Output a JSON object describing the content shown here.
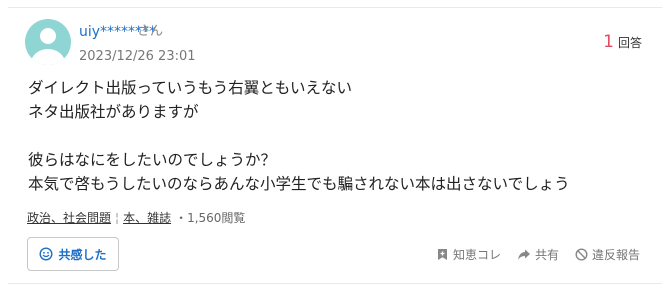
{
  "user": {
    "name": "uiy********",
    "honorific": "さん"
  },
  "post": {
    "date": "2023/12/26 23:01",
    "lines": [
      "ダイレクト出版っていうもう右翼ともいえない",
      "ネタ出版社がありますが",
      "",
      "彼らはなにをしたいのでしょうか？",
      "本気で啓もうしたいのならあんな小学生でも騙されない本は出さないでしょう"
    ]
  },
  "answers": {
    "count": "1",
    "label": "回答"
  },
  "categories": [
    "政治、社会問題",
    "本、雑誌"
  ],
  "category_separator": "¦",
  "views": "・1,560閲覧",
  "buttons": {
    "empathy": "共感した"
  },
  "actions": {
    "wisdom": "知恵コレ",
    "share": "共有",
    "report": "違反報告"
  },
  "colors": {
    "accent": "#1d6fc8",
    "count": "#e24b63",
    "avatar": "#8fd5d4"
  }
}
